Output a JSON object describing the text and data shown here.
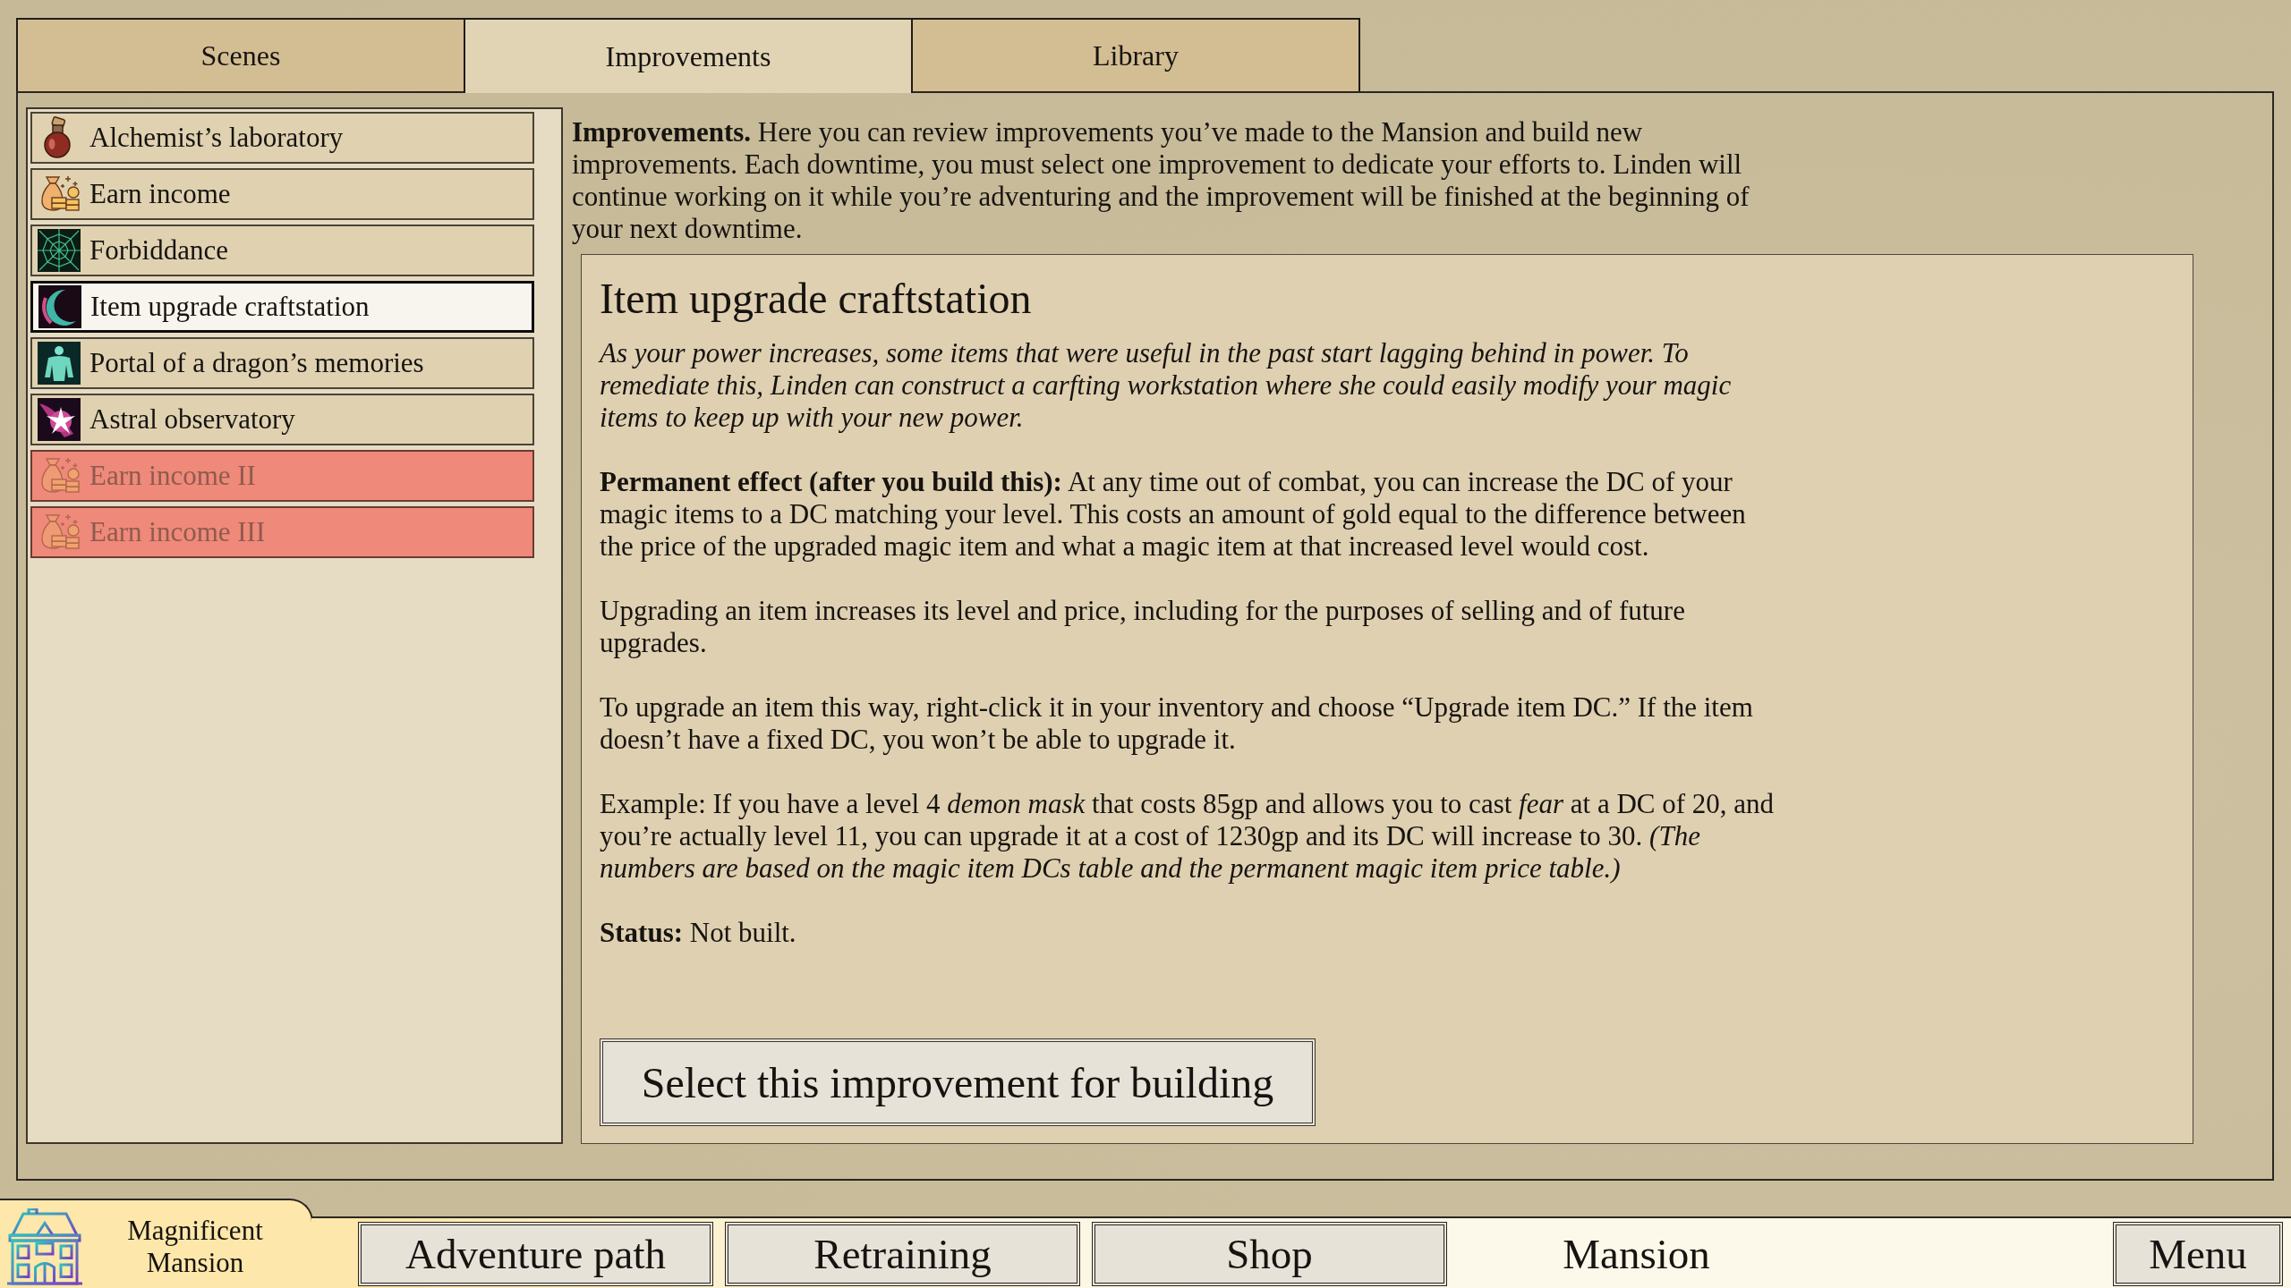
{
  "tabs": [
    {
      "label": "Scenes",
      "selected": false
    },
    {
      "label": "Improvements",
      "selected": true
    },
    {
      "label": "Library",
      "selected": false
    }
  ],
  "improvements": [
    {
      "name": "Alchemist’s laboratory",
      "selected": false,
      "disabled": false
    },
    {
      "name": "Earn income",
      "selected": false,
      "disabled": false
    },
    {
      "name": "Forbiddance",
      "selected": false,
      "disabled": false
    },
    {
      "name": "Item upgrade craftstation",
      "selected": true,
      "disabled": false
    },
    {
      "name": "Portal of a dragon’s memories",
      "selected": false,
      "disabled": false
    },
    {
      "name": "Astral observatory",
      "selected": false,
      "disabled": false
    },
    {
      "name": "Earn income II",
      "selected": false,
      "disabled": true
    },
    {
      "name": "Earn income III",
      "selected": false,
      "disabled": true
    }
  ],
  "intro": "**Improvements.** Here you can review improvements you’ve made to the Mansion and build new improvements. Each downtime, you must select one improvement to dedicate your efforts to. Linden will continue working on it while you’re adventuring and the improvement will be finished at the beginning of your next downtime.",
  "detail": {
    "title": "Item upgrade craftstation",
    "paragraphs": [
      {
        "kind": "flavor",
        "text": "As your power increases, some items that were useful in the past start lagging behind in power. To remediate this, Linden can construct a carfting workstation where she could easily modify your magic items to keep up with your new power."
      },
      {
        "kind": "body",
        "text": "**Permanent effect (after you build this):** At any time out of combat, you can increase the DC of your magic items to a DC matching your level. This costs an amount of gold equal to the difference between the price of the upgraded magic item and what a magic item at that increased level would cost."
      },
      {
        "kind": "body",
        "text": "Upgrading an item increases its level and price, including for the purposes of selling and of future upgrades."
      },
      {
        "kind": "body",
        "text": "To upgrade an item this way, right-click it in your inventory and choose “Upgrade item DC.” If the item doesn’t have a fixed DC, you won’t be able to upgrade it."
      },
      {
        "kind": "body",
        "text": "Example: If you have a level 4 *demon mask* that costs 85gp and allows you to cast *fear* at a DC of 20, and you’re actually level 11, you can upgrade it at a cost of 1230gp and its DC will increase to 30. *(The numbers are based on the magic item DCs table and the permanent magic item price table.)*"
      },
      {
        "kind": "body",
        "text": "**Status:** Not built."
      }
    ],
    "button": "Select this improvement for building"
  },
  "bottom_bar": {
    "logo": "Magnificent Mansion",
    "nav": [
      {
        "label": "Adventure path",
        "selected": false
      },
      {
        "label": "Retraining",
        "selected": false
      },
      {
        "label": "Shop",
        "selected": false
      },
      {
        "label": "Mansion",
        "selected": true
      }
    ],
    "menu": "Menu"
  }
}
